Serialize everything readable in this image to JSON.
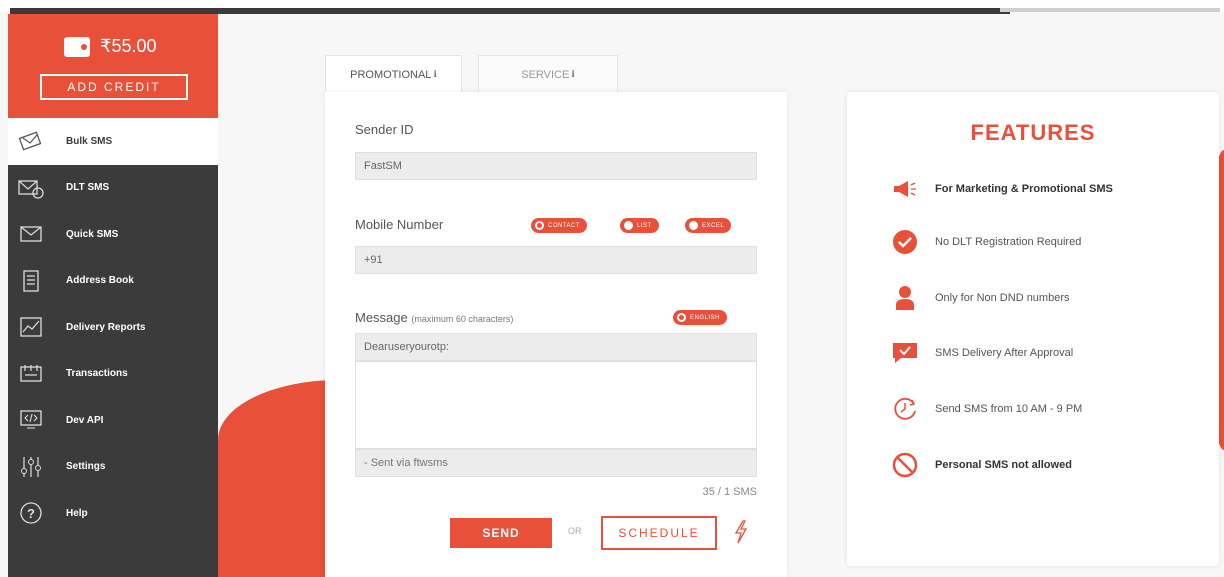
{
  "wallet": {
    "balance": "₹55.00",
    "add_credit_label": "ADD CREDIT"
  },
  "sidebar": {
    "items": [
      {
        "label": "Bulk SMS",
        "icon": "bulk-sms-icon",
        "active": true
      },
      {
        "label": "DLT SMS",
        "icon": "dlt-sms-icon",
        "active": false
      },
      {
        "label": "Quick SMS",
        "icon": "envelope-icon",
        "active": false
      },
      {
        "label": "Address Book",
        "icon": "address-book-icon",
        "active": false
      },
      {
        "label": "Delivery Reports",
        "icon": "chart-icon",
        "active": false
      },
      {
        "label": "Transactions",
        "icon": "transactions-icon",
        "active": false
      },
      {
        "label": "Dev API",
        "icon": "code-icon",
        "active": false
      },
      {
        "label": "Settings",
        "icon": "sliders-icon",
        "active": false
      },
      {
        "label": "Help",
        "icon": "help-icon",
        "active": false
      }
    ]
  },
  "tabs": {
    "promotional": "PROMOTIONAL",
    "service": "SERVICE"
  },
  "form": {
    "sender_label": "Sender ID",
    "sender_value": "FastSM",
    "mobile_label": "Mobile Number",
    "mobile_prefix": "+91",
    "pills": {
      "contact": "CONTACT",
      "list": "LIST",
      "excel": "EXCEL",
      "english": "ENGLISH"
    },
    "message_label": "Message",
    "message_hint": "(maximum 60 characters)",
    "message_header": "Dearuseryourotp:",
    "message_footer": "- Sent via ftwsms",
    "count": "35 / 1 SMS",
    "send_label": "SEND",
    "or_label": "OR",
    "schedule_label": "SCHEDULE"
  },
  "features": {
    "title": "FEATURES",
    "items": [
      {
        "text": "For Marketing & Promotional SMS",
        "icon": "megaphone-icon",
        "bold": true
      },
      {
        "text": "No DLT Registration Required",
        "icon": "check-circle-icon",
        "bold": false
      },
      {
        "text": "Only for Non DND numbers",
        "icon": "user-icon",
        "bold": false
      },
      {
        "text": "SMS Delivery After Approval",
        "icon": "chat-check-icon",
        "bold": false
      },
      {
        "text": "Send SMS from 10 AM - 9 PM",
        "icon": "clock-icon",
        "bold": false
      },
      {
        "text": "Personal SMS not allowed",
        "icon": "prohibited-icon",
        "bold": true
      }
    ]
  },
  "colors": {
    "accent": "#e8503a",
    "sidebar": "#3b3b3b"
  }
}
